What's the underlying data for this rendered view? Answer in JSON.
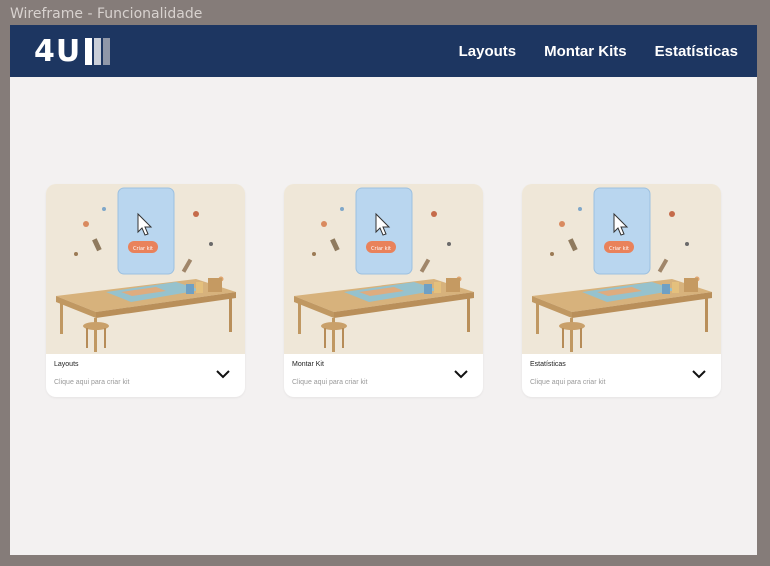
{
  "frame": {
    "label": "Wireframe - Funcionalidade"
  },
  "header": {
    "logo_text": "4U",
    "nav": [
      {
        "label": "Layouts"
      },
      {
        "label": "Montar Kits"
      },
      {
        "label": "Estatísticas"
      }
    ]
  },
  "cards": [
    {
      "title": "Layouts",
      "subtitle": "Clique aqui para criar kit",
      "button_text": "Criar kit"
    },
    {
      "title": "Montar Kit",
      "subtitle": "Clique aqui para criar kit",
      "button_text": "Criar kit"
    },
    {
      "title": "Estatísticas",
      "subtitle": "Clique aqui para criar kit",
      "button_text": "Criar kit"
    }
  ],
  "colors": {
    "navbar": "#1d3661",
    "canvas": "#f3f1f1",
    "outer": "#857c79",
    "accent": "#e9825b"
  }
}
